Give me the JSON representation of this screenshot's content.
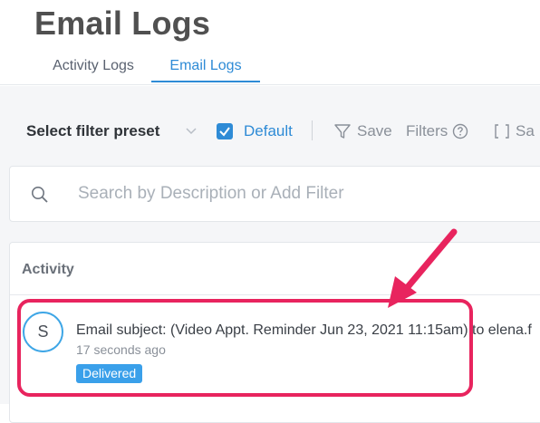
{
  "page": {
    "title": "Email Logs"
  },
  "tabs": [
    {
      "label": "Activity Logs",
      "active": false
    },
    {
      "label": "Email Logs",
      "active": true
    }
  ],
  "toolbar": {
    "preset_label": "Select filter preset",
    "default_checked": true,
    "default_label": "Default",
    "save_label": "Save",
    "filters_label": "Filters",
    "save_view_label": "Sa"
  },
  "search": {
    "placeholder": "Search by Description or Add Filter",
    "value": ""
  },
  "activity": {
    "header": "Activity",
    "items": [
      {
        "avatar_initial": "S",
        "subject": "Email subject: (Video Appt. Reminder Jun 23, 2021 11:15am) to elena.f",
        "time": "17 seconds ago",
        "status": "Delivered"
      }
    ]
  },
  "colors": {
    "accent": "#2e8bd6",
    "badge": "#3aa0ea",
    "annotation": "#e8245e",
    "background": "#f5f6f8"
  },
  "icons": [
    "chevron-down-icon",
    "check-icon",
    "filter-icon",
    "help-circle-icon",
    "bracket-icon",
    "search-icon",
    "arrow-annotation"
  ]
}
